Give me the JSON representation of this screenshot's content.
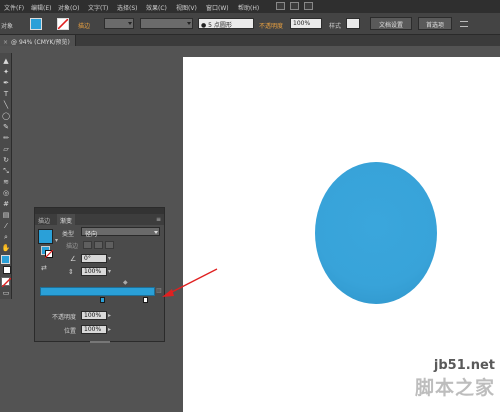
{
  "menubar": {
    "items": [
      "文件(F)",
      "编辑(E)",
      "对象(O)",
      "文字(T)",
      "选择(S)",
      "效果(C)",
      "视图(V)",
      "窗口(W)",
      "帮助(H)"
    ]
  },
  "controlbar": {
    "selection_label": "对象",
    "stroke_label": "描边",
    "brush_value": "5 点圆形",
    "opacity_label": "不透明度",
    "opacity_value": "100%",
    "style_label": "样式",
    "doc_setup_button": "文档设置",
    "preferences_button": "首选项"
  },
  "document_tab": {
    "close_glyph": "×",
    "title": "@ 94% (CMYK/预览)"
  },
  "tools": {
    "type_tool_glyph": "T"
  },
  "gradient_panel": {
    "tab_stroke": "描边",
    "tab_gradient": "渐变",
    "menu_glyph": "≡",
    "type_label": "类型",
    "type_value": "径向",
    "stroke_label": "描边",
    "angle_value": "0°",
    "aspect_value": "100%",
    "opacity_label": "不透明度",
    "opacity_value": "100%",
    "location_label": "位置",
    "location_value": "100%",
    "gradient_color": "#2aa0d8",
    "gradient_stops": [
      {
        "position": 0.55,
        "color": "#2aa0d8"
      },
      {
        "position": 0.92,
        "color": "#ffffff"
      }
    ]
  },
  "artboard": {
    "circle_color": "#38a3d9"
  },
  "watermark": {
    "site": "jb51.net",
    "name": "脚本之家"
  },
  "annotation": {
    "arrow_color": "#e02020"
  }
}
